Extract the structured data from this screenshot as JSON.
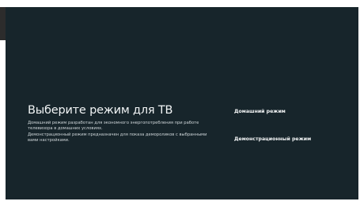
{
  "dialog": {
    "title": "Выберите режим для ТВ",
    "description": [
      "Домашний режим разработан для экономного энергопотребления при работе телевизора в домашних условиях.",
      "Демонстрационный режим предназначен для показа демороликов с выбранными вами настройками."
    ]
  },
  "options": [
    {
      "label": "Домашний режим",
      "selected": true
    },
    {
      "label": "Демонстрационный режим",
      "selected": false
    }
  ],
  "colors": {
    "background": "#17252b",
    "text": "#f1f4f5"
  }
}
